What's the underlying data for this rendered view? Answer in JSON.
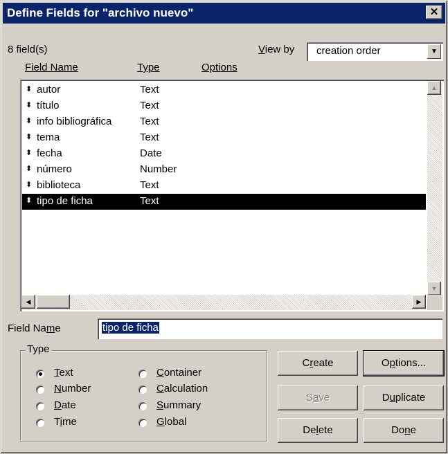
{
  "window": {
    "title": "Define Fields for \"archivo nuevo\"",
    "close": "✕"
  },
  "header": {
    "field_count": "8 field(s)",
    "view_by_label": "View by",
    "view_by_value": "creation order",
    "columns": {
      "name": "Field Name",
      "type": "Type",
      "options": "Options"
    }
  },
  "fields": [
    {
      "name": "autor",
      "type": "Text"
    },
    {
      "name": "título",
      "type": "Text"
    },
    {
      "name": "info bibliográfica",
      "type": "Text"
    },
    {
      "name": "tema",
      "type": "Text"
    },
    {
      "name": "fecha",
      "type": "Date"
    },
    {
      "name": "número",
      "type": "Number"
    },
    {
      "name": "biblioteca",
      "type": "Text"
    },
    {
      "name": "tipo de ficha",
      "type": "Text"
    }
  ],
  "selected_field_index": 7,
  "field_name": {
    "label": "Field Name",
    "value": "tipo de ficha"
  },
  "type_group": {
    "label": "Type",
    "options": [
      "Text",
      "Number",
      "Date",
      "Time",
      "Container",
      "Calculation",
      "Summary",
      "Global"
    ],
    "selected": "Text"
  },
  "buttons": {
    "create": "Create",
    "options": "Options...",
    "save": "Save",
    "duplicate": "Duplicate",
    "delete": "Delete",
    "done": "Done"
  },
  "colors": {
    "titlebar": "#0a246a",
    "face": "#d4d0c8",
    "selection": "#000000"
  }
}
